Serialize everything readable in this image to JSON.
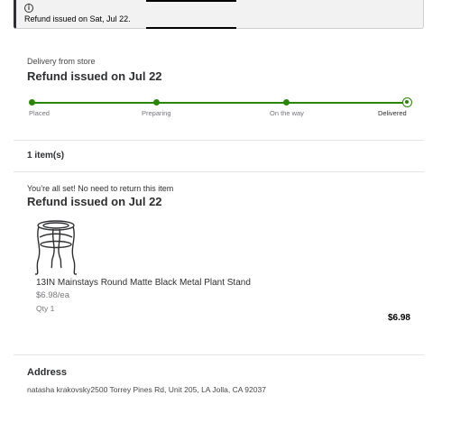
{
  "banner": {
    "icon": "info-icon",
    "text": "Refund issued on Sat, Jul 22."
  },
  "order": {
    "delivery_type": "Delivery from store",
    "status_title": "Refund issued on Jul 22",
    "progress_fraction": 1.0,
    "steps": [
      "Placed",
      "Preparing",
      "On the way",
      "Delivered"
    ],
    "accent_color": "#2a8703"
  },
  "items": {
    "count_label": "1 item(s)",
    "return_note": "You’re all set! No need to return this item",
    "refund_title": "Refund issued on Jul 22",
    "product": {
      "image_icon": "plant-stand-image",
      "name": "13IN Mainstays Round Matte Black Metal Plant Stand",
      "unit_price": "$6.98/ea",
      "qty": "Qty 1",
      "price": "$6.98"
    }
  },
  "address": {
    "title": "Address",
    "text": "natasha krakovsky2500 Torrey Pines Rd, Unit 205, LA Jolla, CA 92037"
  }
}
